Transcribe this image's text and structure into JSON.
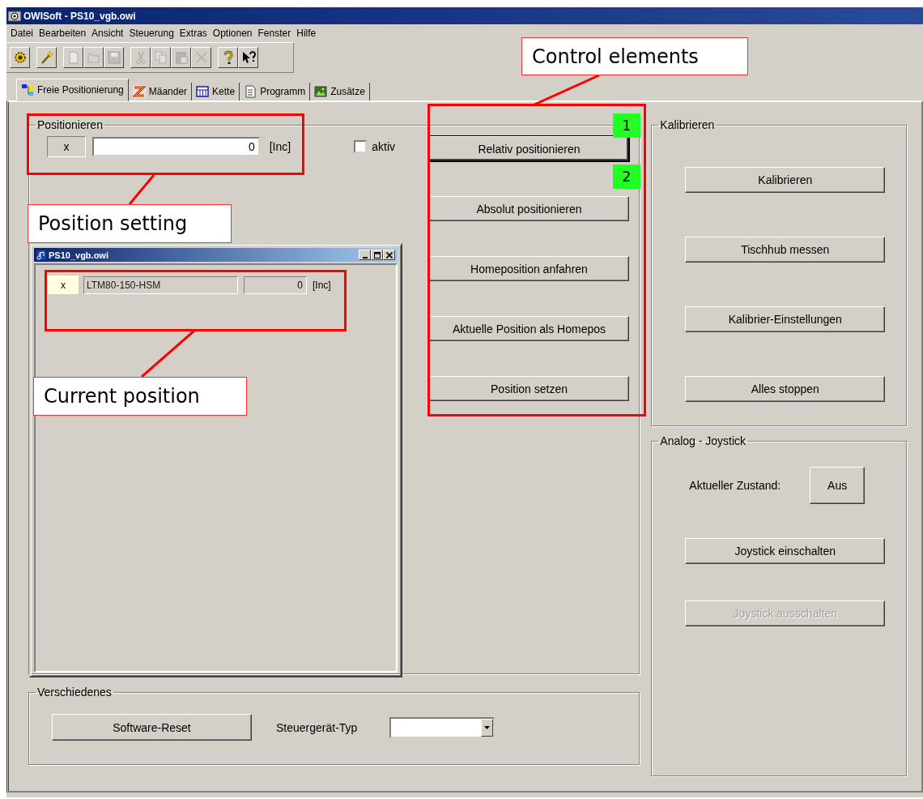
{
  "window": {
    "title": "OWISoft - PS10_vgb.owi"
  },
  "menu": [
    "Datei",
    "Bearbeiten",
    "Ansicht",
    "Steuerung",
    "Extras",
    "Optionen",
    "Fenster",
    "Hilfe"
  ],
  "toolbar": [
    [
      {
        "disabled": false
      }
    ],
    [
      {
        "disabled": false
      }
    ],
    [
      {
        "disabled": true
      },
      {
        "disabled": true
      },
      {
        "disabled": true
      }
    ],
    [
      {
        "disabled": true
      },
      {
        "disabled": true
      },
      {
        "disabled": true
      },
      {
        "disabled": true
      }
    ],
    [
      {
        "disabled": false
      },
      {
        "disabled": false
      }
    ]
  ],
  "tabs": [
    {
      "label": "Freie Positionierung",
      "selected": true
    },
    {
      "label": "Mäander",
      "selected": false
    },
    {
      "label": "Kette",
      "selected": false
    },
    {
      "label": "Programm",
      "selected": false
    },
    {
      "label": "Zusätze",
      "selected": false
    }
  ],
  "positioning": {
    "title": "Positionieren",
    "axis": "x",
    "value": "0",
    "unit": "[Inc]",
    "active": {
      "label": "aktiv",
      "checked": false
    }
  },
  "position_window": {
    "title": "PS10_vgb.owi",
    "axis": "x",
    "motor": "LTM80-150-HSM",
    "value": "0",
    "unit": "[Inc]"
  },
  "control_buttons": [
    {
      "label": "Relativ positionieren",
      "focused": true
    },
    {
      "label": "Absolut positionieren",
      "focused": false
    },
    {
      "label": "Homeposition anfahren",
      "focused": false
    },
    {
      "label": "Aktuelle Position als Homepos",
      "focused": false
    },
    {
      "label": "Position setzen",
      "focused": false
    }
  ],
  "calibration": {
    "title": "Kalibrieren",
    "buttons": [
      "Kalibrieren",
      "Tischhub messen",
      "Kalibrier-Einstellungen",
      "Alles stoppen"
    ]
  },
  "joystick": {
    "title": "Analog - Joystick",
    "state_label": "Aktueller Zustand:",
    "state": "Aus",
    "buttons": [
      {
        "label": "Joystick einschalten",
        "disabled": false
      },
      {
        "label": "Joystick ausschalten",
        "disabled": true
      }
    ]
  },
  "misc": {
    "title": "Verschiedenes",
    "button": "Software-Reset",
    "type_label": "Steuergerät-Typ"
  },
  "annotations": {
    "callouts": [
      "Position setting",
      "Current position",
      "Control elements"
    ],
    "badges": [
      "1",
      "2"
    ]
  }
}
